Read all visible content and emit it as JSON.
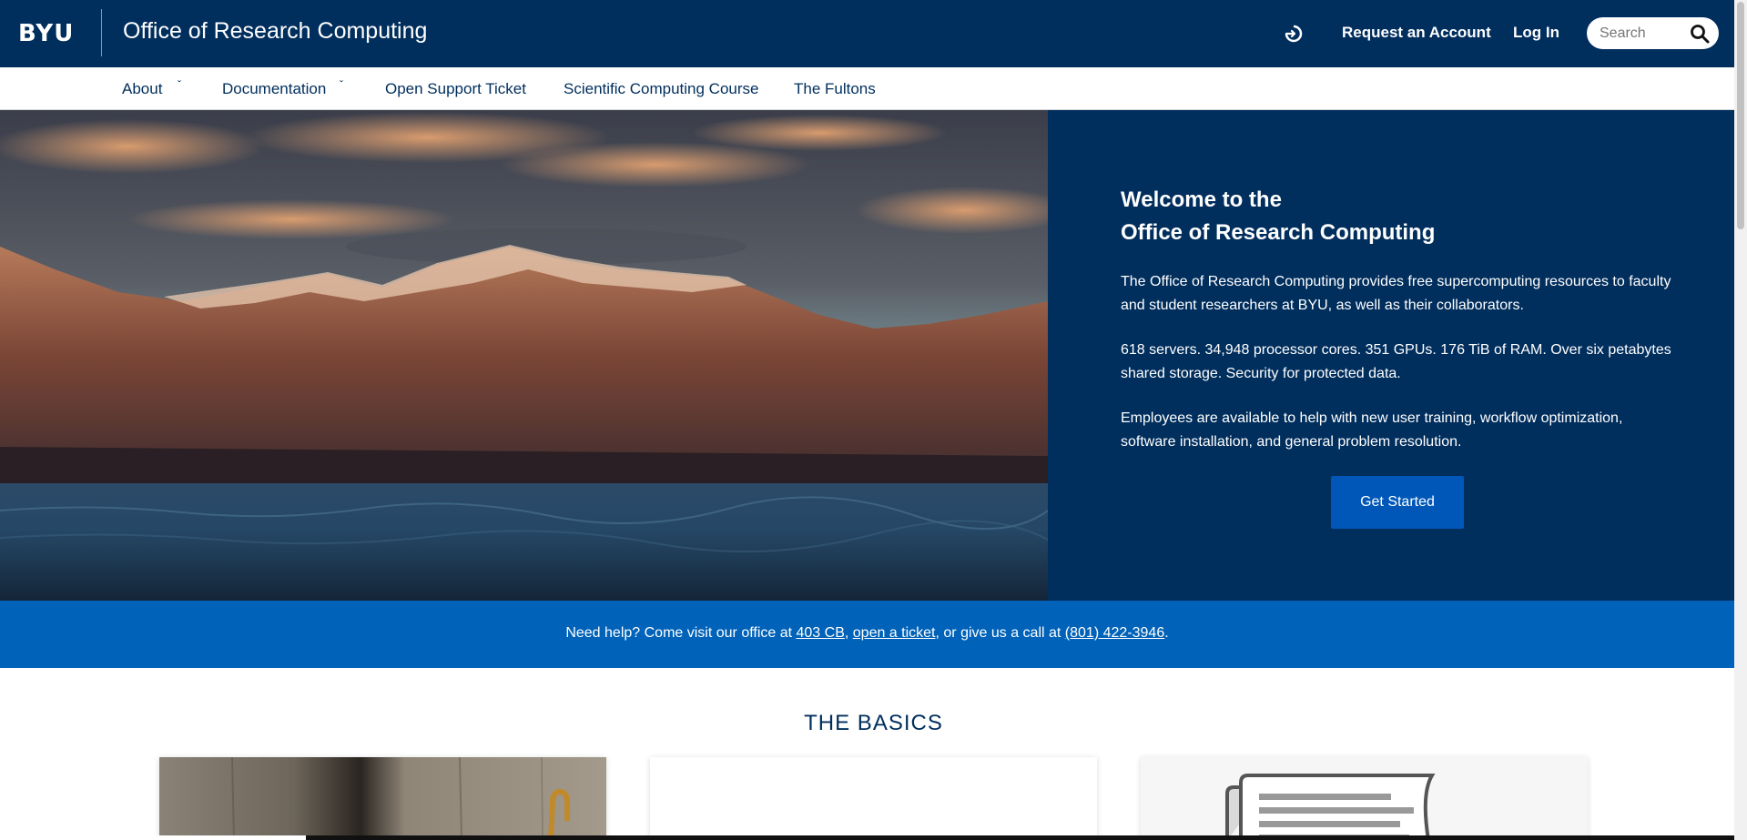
{
  "header": {
    "logo": "BYU",
    "site_title": "Office of Research Computing",
    "request_account": "Request an Account",
    "log_in": "Log In",
    "search_placeholder": "Search"
  },
  "nav": {
    "items": [
      {
        "label": "About",
        "has_dropdown": true
      },
      {
        "label": "Documentation",
        "has_dropdown": true
      },
      {
        "label": "Open Support Ticket",
        "has_dropdown": false
      },
      {
        "label": "Scientific Computing Course",
        "has_dropdown": false
      },
      {
        "label": "The Fultons",
        "has_dropdown": false
      }
    ]
  },
  "hero": {
    "title_line1": "Welcome to the",
    "title_line2": "Office of Research Computing",
    "paragraph1": "The Office of Research Computing provides free supercomputing resources to faculty and student researchers at BYU, as well as their collaborators.",
    "paragraph2": "618 servers. 34,948 processor cores. 351 GPUs. 176 TiB of RAM. Over six petabytes shared storage. Security for protected data.",
    "paragraph3": "Employees are available to help with new user training, workflow optimization, software installation, and general problem resolution.",
    "cta": "Get Started"
  },
  "help_bar": {
    "prefix": "Need help? Come visit our office at ",
    "office_link": "403 CB",
    "sep1": ", ",
    "ticket_link": "open a ticket",
    "middle": ", or give us a call at ",
    "phone_link": "(801) 422-3946",
    "suffix": "."
  },
  "basics": {
    "title": "THE BASICS"
  },
  "colors": {
    "navy": "#002e5d",
    "royal": "#0062b8",
    "button": "#0057b8"
  },
  "icons": [
    "sign-in-icon",
    "search-icon",
    "chevron-down-icon"
  ]
}
